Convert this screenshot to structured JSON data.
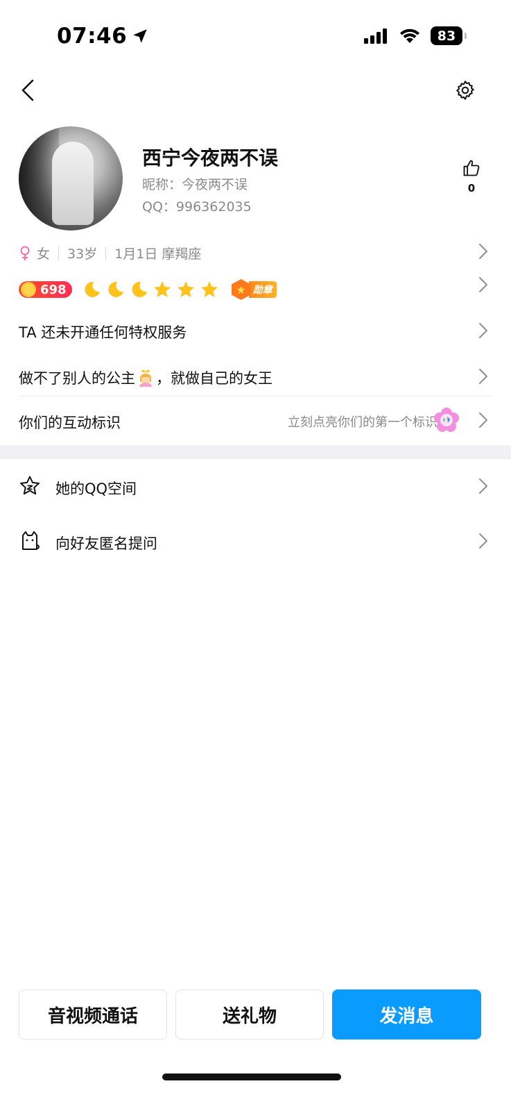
{
  "status_bar": {
    "time": "07:46",
    "battery": "83"
  },
  "profile": {
    "name": "西宁今夜两不误",
    "nickname": "昵称：今夜两不误",
    "qq": "QQ：996362035",
    "likes": "0",
    "gender": "女",
    "age": "33岁",
    "birthday": "1月1日 摩羯座",
    "level": "698",
    "medal_label": "勋章"
  },
  "rows": {
    "privilege": "TA 还未开通任何特权服务",
    "signature_a": "做不了别人的公主",
    "signature_b": "，就做自己的女王",
    "interaction_label": "你们的互动标识",
    "interaction_hint": "立刻点亮你们的第一个标识"
  },
  "list": [
    {
      "label": "她的QQ空间",
      "icon": "star-face-icon"
    },
    {
      "label": "向好友匿名提问",
      "icon": "cat-icon"
    }
  ],
  "actions": {
    "call": "音视频通话",
    "gift": "送礼物",
    "message": "发消息"
  },
  "colors": {
    "primary": "#0a9bff",
    "level_badge": "#ff3b30",
    "female": "#ff5fa2",
    "medal": "#ff8a1a"
  }
}
